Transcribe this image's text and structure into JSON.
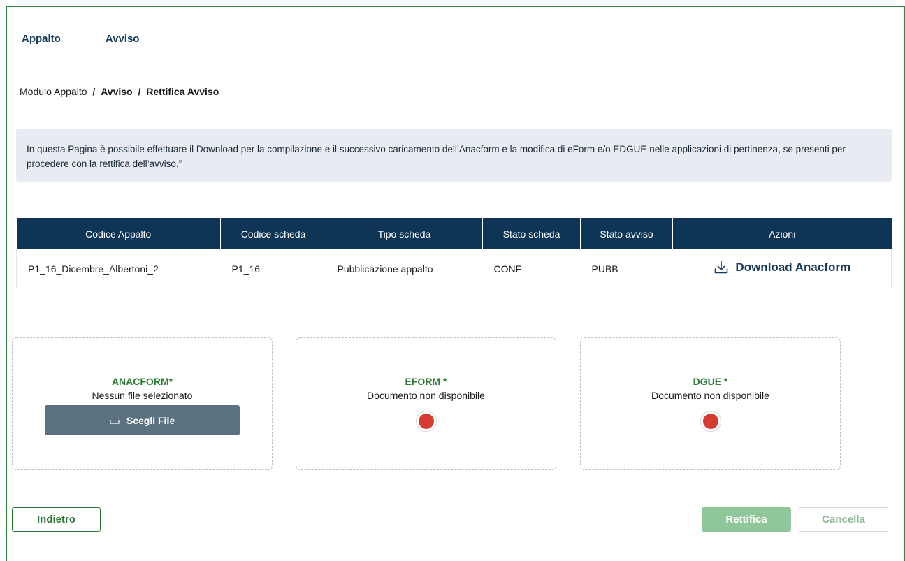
{
  "nav": {
    "items": [
      "Appalto",
      "Avviso"
    ]
  },
  "breadcrumb": {
    "root": "Modulo Appalto",
    "sep": "/",
    "level1": "Avviso",
    "level2": "Rettifica Avviso"
  },
  "info": {
    "text": "In questa Pagina è possibile effettuare il Download per la compilazione e il successivo caricamento dell’Anacform e la modifica di eForm e/o EDGUE nelle applicazioni di pertinenza, se presenti per procedere con la rettifica dell’avviso.”"
  },
  "table": {
    "headers": [
      "Codice Appalto",
      "Codice scheda",
      "Tipo scheda",
      "Stato scheda",
      "Stato avviso",
      "Azioni"
    ],
    "rows": [
      {
        "codice_appalto": "P1_16_Dicembre_Albertoni_2",
        "codice_scheda": "P1_16",
        "tipo_scheda": "Pubblicazione appalto",
        "stato_scheda": "CONF",
        "stato_avviso": "PUBB",
        "azione": "Download Anacform"
      }
    ]
  },
  "uploads": {
    "anacform": {
      "title": "ANACFORM*",
      "status": "Nessun file selezionato",
      "button": "Scegli File"
    },
    "eform": {
      "title": "EFORM *",
      "status": "Documento non disponibile"
    },
    "dgue": {
      "title": "DGUE *",
      "status": "Documento non disponibile"
    }
  },
  "actions": {
    "back": "Indietro",
    "rettifica": "Rettifica",
    "cancel": "Cancella"
  },
  "colors": {
    "primary_green": "#2e7a35",
    "navy": "#0e3556",
    "status_red": "#d43c33",
    "disabled_green": "#8fc79a"
  }
}
